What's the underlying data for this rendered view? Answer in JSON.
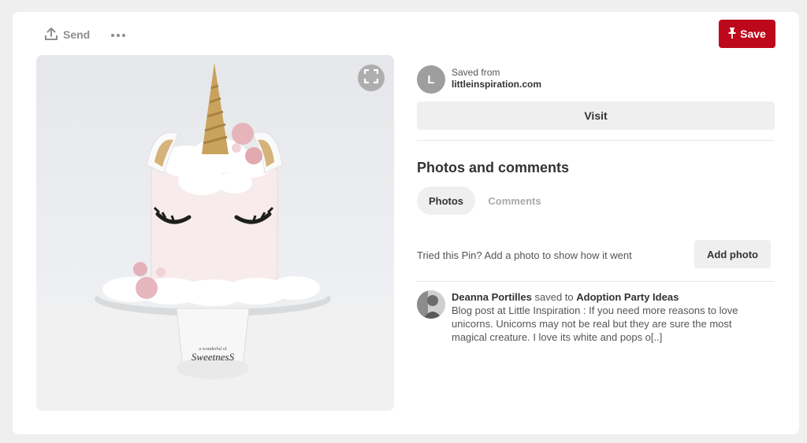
{
  "toolbar": {
    "send_label": "Send",
    "more_label": "More options",
    "save_label": "Save"
  },
  "pin": {
    "image_alt": "Unicorn cake",
    "stand_text_top": "a wonderful of",
    "stand_text_main": "SweetnesS"
  },
  "source": {
    "avatar_letter": "L",
    "saved_from_label": "Saved from",
    "domain": "littleinspiration.com",
    "visit_label": "Visit"
  },
  "photos_comments": {
    "title": "Photos and comments",
    "tabs": [
      {
        "label": "Photos",
        "active": true
      },
      {
        "label": "Comments",
        "active": false
      }
    ],
    "prompt": "Tried this Pin? Add a photo to show how it went",
    "add_photo_label": "Add photo"
  },
  "activity": {
    "user_name": "Deanna Portilles",
    "saved_to_text": "saved to",
    "board_name": "Adoption Party Ideas",
    "description": "Blog post at Little Inspiration : If you need more reasons to love unicorns. Unicorns may not be real but they are sure the most magical creature. I love its white and pops o[..]"
  },
  "colors": {
    "brand_red": "#bd081c",
    "page_bg": "#efefef",
    "button_gray": "#efefef"
  },
  "icons": [
    "upload-icon",
    "ellipsis-icon",
    "pin-icon",
    "fullscreen-icon"
  ]
}
